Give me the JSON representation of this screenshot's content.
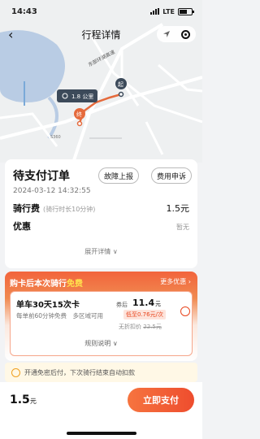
{
  "status_bar": {
    "time": "14:43",
    "network": "LTE"
  },
  "nav": {
    "title": "行程详情"
  },
  "map": {
    "distance_label": "1.8 公里",
    "start_marker": "起",
    "end_marker": "终",
    "road_label": "东部环湖高速",
    "road_code": "S360"
  },
  "order": {
    "status": "待支付订单",
    "time": "2024-03-12 14:32:55",
    "report_label": "故障上报",
    "appeal_label": "费用申诉",
    "fee_label": "骑行费",
    "fee_note": "(骑行时长10分钟)",
    "fee_value": "1.5元",
    "discount_label": "优惠",
    "discount_value": "暂无",
    "expand_label": "展开详情"
  },
  "promo": {
    "headline_prefix": "购卡后本次骑行",
    "headline_highlight": "免费",
    "more_label": "更多优惠",
    "card_title": "单车30天15次卡",
    "card_desc": "每单前60分钟免费　多区域可用",
    "price_prefix": "券后",
    "price_value": "11.4",
    "price_unit": "元",
    "price_tag": "低至0.76元/次",
    "orig_price_prefix": "无折扣价",
    "orig_price": "22.5元",
    "rules_label": "规则说明"
  },
  "autopay": {
    "text": "开通免密后付，下次骑行结束自动扣款"
  },
  "footer": {
    "total_value": "1.5",
    "total_unit": "元",
    "pay_label": "立即支付"
  },
  "colors": {
    "accent": "#ee4d2e",
    "route": "#e56a3c",
    "lake": "#b9cce4"
  }
}
